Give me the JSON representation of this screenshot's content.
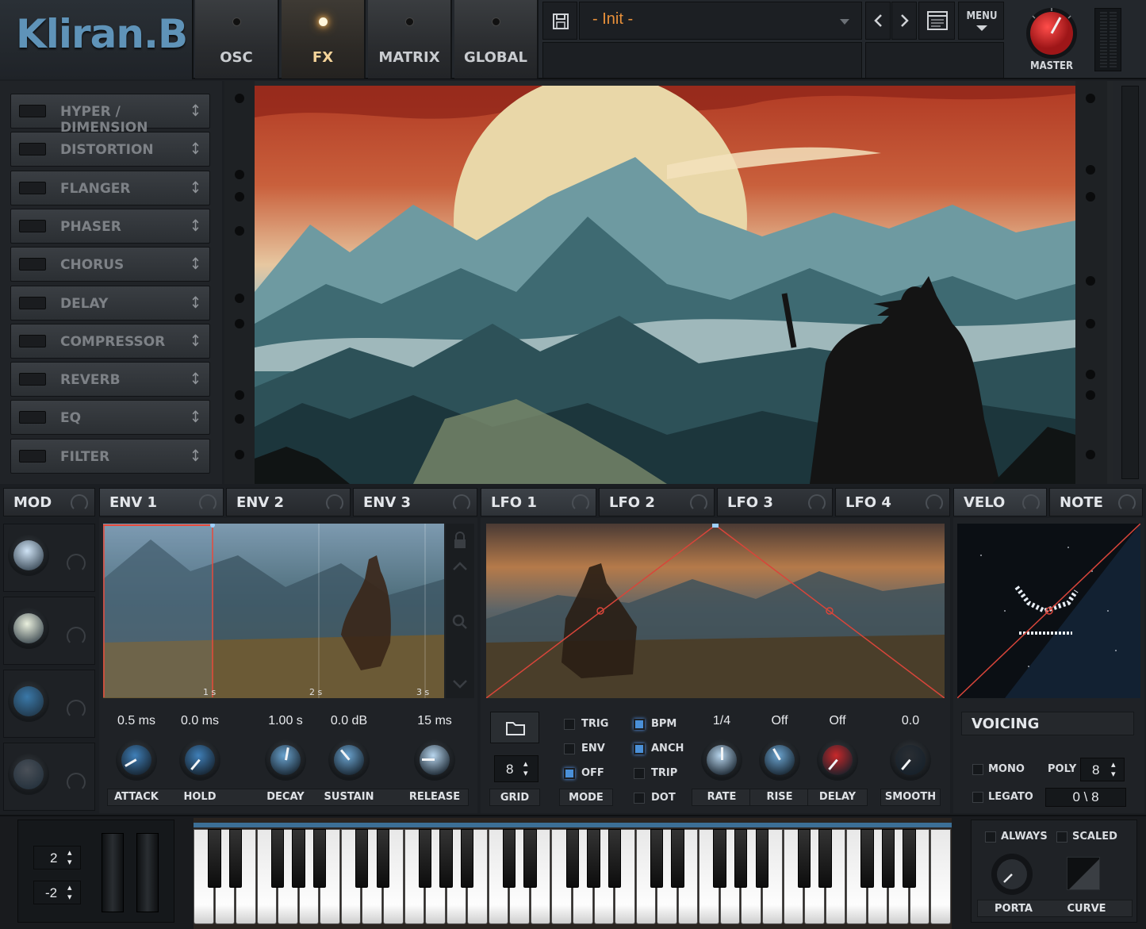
{
  "logo": "Kliran.B",
  "nav_tabs": [
    {
      "label": "OSC"
    },
    {
      "label": "FX"
    },
    {
      "label": "MATRIX"
    },
    {
      "label": "GLOBAL"
    }
  ],
  "active_tab": "FX",
  "preset": {
    "name": "- Init -"
  },
  "menu_label": "MENU",
  "master_label": "MASTER",
  "fx_chain": [
    {
      "label": "HYPER / DIMENSION"
    },
    {
      "label": "DISTORTION"
    },
    {
      "label": "FLANGER"
    },
    {
      "label": "PHASER"
    },
    {
      "label": "CHORUS"
    },
    {
      "label": "DELAY"
    },
    {
      "label": "COMPRESSOR"
    },
    {
      "label": "REVERB"
    },
    {
      "label": "EQ"
    },
    {
      "label": "FILTER"
    }
  ],
  "mod_tab": "MOD",
  "env_tabs": [
    {
      "label": "ENV 1"
    },
    {
      "label": "ENV 2"
    },
    {
      "label": "ENV 3"
    }
  ],
  "lfo_tabs": [
    {
      "label": "LFO 1"
    },
    {
      "label": "LFO 2"
    },
    {
      "label": "LFO 3"
    },
    {
      "label": "LFO 4"
    }
  ],
  "velo_tabs": [
    {
      "label": "VELO"
    },
    {
      "label": "NOTE"
    }
  ],
  "env": {
    "time_marks": [
      "1 s",
      "2 s",
      "3 s"
    ],
    "knobs": [
      {
        "label": "ATTACK",
        "value": "0.5 ms"
      },
      {
        "label": "HOLD",
        "value": "0.0 ms"
      },
      {
        "label": "DECAY",
        "value": "1.00 s"
      },
      {
        "label": "SUSTAIN",
        "value": "0.0 dB"
      },
      {
        "label": "RELEASE",
        "value": "15 ms"
      }
    ]
  },
  "lfo": {
    "grid_value": "8",
    "grid_label": "GRID",
    "mode_label": "MODE",
    "mode_options": [
      {
        "label": "TRIG",
        "on": false
      },
      {
        "label": "ENV",
        "on": false
      },
      {
        "label": "OFF",
        "on": true
      }
    ],
    "flags": [
      {
        "label": "BPM",
        "on": true
      },
      {
        "label": "ANCH",
        "on": true
      },
      {
        "label": "TRIP",
        "on": false
      },
      {
        "label": "DOT",
        "on": false
      }
    ],
    "knobs": [
      {
        "label": "RATE",
        "value": "1/4"
      },
      {
        "label": "RISE",
        "value": "Off"
      },
      {
        "label": "DELAY",
        "value": "Off"
      },
      {
        "label": "SMOOTH",
        "value": "0.0"
      }
    ]
  },
  "voicing": {
    "title": "VOICING",
    "mono_label": "MONO",
    "legato_label": "LEGATO",
    "poly_label": "POLY",
    "poly_value": "8",
    "voice_count": "0  \\ 8"
  },
  "keyboard": {
    "octave_up": "2",
    "octave_down": "-2"
  },
  "glide": {
    "always_label": "ALWAYS",
    "scaled_label": "SCALED",
    "porta_label": "PORTA",
    "curve_label": "CURVE"
  },
  "colors": {
    "accent_orange": "#e8903a",
    "logo_blue": "#5f93b8",
    "master_red": "#c8282a",
    "led_blue": "#4a90d8"
  }
}
